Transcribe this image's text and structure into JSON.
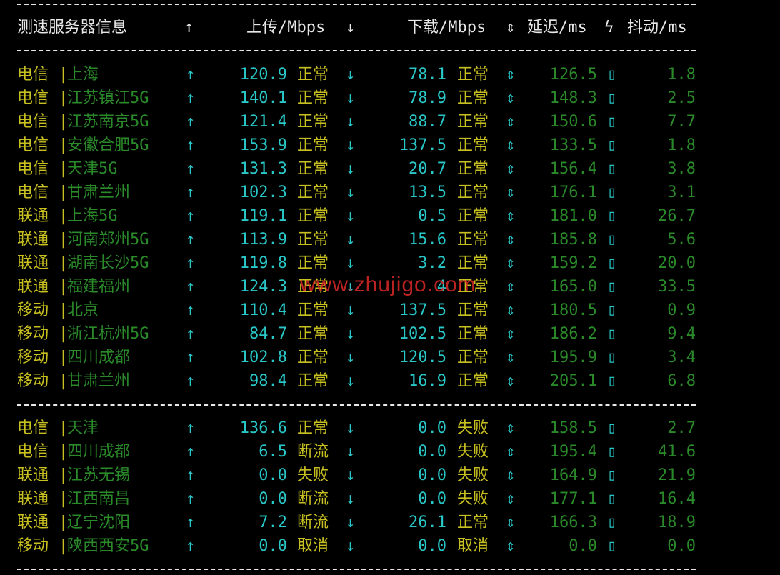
{
  "header": {
    "server_info": "测速服务器信息",
    "up_arrow": "↑",
    "upload": "上传/Mbps",
    "down_arrow": "↓",
    "download": "下载/Mbps",
    "updown_arrow": "⇕",
    "latency": "延迟/ms",
    "bolt": "ϟ",
    "jitter": "抖动/ms"
  },
  "glyphs": {
    "bar": "|",
    "up": "↑",
    "down": "↓",
    "updown": "⇕",
    "box": "▯"
  },
  "rows": [
    {
      "isp": "电信",
      "loc": "上海",
      "up": "120.9",
      "up_status": "正常",
      "down": "78.1",
      "down_status": "正常",
      "latency": "126.5",
      "jitter": "1.8"
    },
    {
      "isp": "电信",
      "loc": "江苏镇江5G",
      "up": "140.1",
      "up_status": "正常",
      "down": "78.9",
      "down_status": "正常",
      "latency": "148.3",
      "jitter": "2.5"
    },
    {
      "isp": "电信",
      "loc": "江苏南京5G",
      "up": "121.4",
      "up_status": "正常",
      "down": "88.7",
      "down_status": "正常",
      "latency": "150.6",
      "jitter": "7.7"
    },
    {
      "isp": "电信",
      "loc": "安徽合肥5G",
      "up": "153.9",
      "up_status": "正常",
      "down": "137.5",
      "down_status": "正常",
      "latency": "133.5",
      "jitter": "1.8"
    },
    {
      "isp": "电信",
      "loc": "天津5G",
      "up": "131.3",
      "up_status": "正常",
      "down": "20.7",
      "down_status": "正常",
      "latency": "156.4",
      "jitter": "3.8"
    },
    {
      "isp": "电信",
      "loc": "甘肃兰州",
      "up": "102.3",
      "up_status": "正常",
      "down": "13.5",
      "down_status": "正常",
      "latency": "176.1",
      "jitter": "3.1"
    },
    {
      "isp": "联通",
      "loc": "上海5G",
      "up": "119.1",
      "up_status": "正常",
      "down": "0.5",
      "down_status": "正常",
      "latency": "181.0",
      "jitter": "26.7"
    },
    {
      "isp": "联通",
      "loc": "河南郑州5G",
      "up": "113.9",
      "up_status": "正常",
      "down": "15.6",
      "down_status": "正常",
      "latency": "185.8",
      "jitter": "5.6"
    },
    {
      "isp": "联通",
      "loc": "湖南长沙5G",
      "up": "119.8",
      "up_status": "正常",
      "down": "3.2",
      "down_status": "正常",
      "latency": "159.2",
      "jitter": "20.0"
    },
    {
      "isp": "联通",
      "loc": "福建福州",
      "up": "124.3",
      "up_status": "正常",
      "down": "4",
      "down_status": "正常",
      "latency": "165.0",
      "jitter": "33.5"
    },
    {
      "isp": "移动",
      "loc": "北京",
      "up": "110.4",
      "up_status": "正常",
      "down": "137.5",
      "down_status": "正常",
      "latency": "180.5",
      "jitter": "0.9"
    },
    {
      "isp": "移动",
      "loc": "浙江杭州5G",
      "up": "84.7",
      "up_status": "正常",
      "down": "102.5",
      "down_status": "正常",
      "latency": "186.2",
      "jitter": "9.4"
    },
    {
      "isp": "移动",
      "loc": "四川成都",
      "up": "102.8",
      "up_status": "正常",
      "down": "120.5",
      "down_status": "正常",
      "latency": "195.9",
      "jitter": "3.4"
    },
    {
      "isp": "移动",
      "loc": "甘肃兰州",
      "up": "98.4",
      "up_status": "正常",
      "down": "16.9",
      "down_status": "正常",
      "latency": "205.1",
      "jitter": "6.8"
    },
    {
      "isp": "电信",
      "loc": "天津",
      "up": "136.6",
      "up_status": "正常",
      "down": "0.0",
      "down_status": "失败",
      "latency": "158.5",
      "jitter": "2.7"
    },
    {
      "isp": "电信",
      "loc": "四川成都",
      "up": "6.5",
      "up_status": "断流",
      "down": "0.0",
      "down_status": "失败",
      "latency": "195.4",
      "jitter": "41.6"
    },
    {
      "isp": "联通",
      "loc": "江苏无锡",
      "up": "0.0",
      "up_status": "失败",
      "down": "0.0",
      "down_status": "失败",
      "latency": "164.9",
      "jitter": "21.9"
    },
    {
      "isp": "联通",
      "loc": "江西南昌",
      "up": "0.0",
      "up_status": "断流",
      "down": "0.0",
      "down_status": "失败",
      "latency": "177.1",
      "jitter": "16.4"
    },
    {
      "isp": "联通",
      "loc": "辽宁沈阳",
      "up": "7.2",
      "up_status": "断流",
      "down": "26.1",
      "down_status": "正常",
      "latency": "166.3",
      "jitter": "18.9"
    },
    {
      "isp": "移动",
      "loc": "陕西西安5G",
      "up": "0.0",
      "up_status": "取消",
      "down": "0.0",
      "down_status": "取消",
      "latency": "0.0",
      "jitter": "0.0"
    }
  ],
  "watermark": "www.zhujigo.com"
}
